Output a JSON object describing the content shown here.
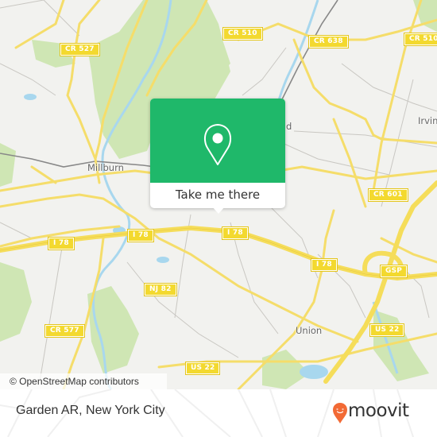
{
  "map": {
    "attribution": "© OpenStreetMap contributors",
    "road_shields": [
      {
        "label": "CR 527"
      },
      {
        "label": "CR 510"
      },
      {
        "label": "CR 638"
      },
      {
        "label": "CR 510"
      },
      {
        "label": "CR 601"
      },
      {
        "label": "I 78"
      },
      {
        "label": "I 78"
      },
      {
        "label": "I 78"
      },
      {
        "label": "I 78"
      },
      {
        "label": "NJ 82"
      },
      {
        "label": "GSP"
      },
      {
        "label": "CR 577"
      },
      {
        "label": "US 22"
      },
      {
        "label": "US 22"
      }
    ],
    "places": [
      {
        "label": "Millburn"
      },
      {
        "label": "Irvin"
      },
      {
        "label": "Union"
      },
      {
        "label": "d"
      }
    ]
  },
  "popup": {
    "icon": "map-pin-icon",
    "button_label": "Take me there",
    "color": "#1fb86a"
  },
  "footer": {
    "place_name": "Garden AR, New York City",
    "brand": "moovit",
    "brand_color": "#f26a35"
  }
}
